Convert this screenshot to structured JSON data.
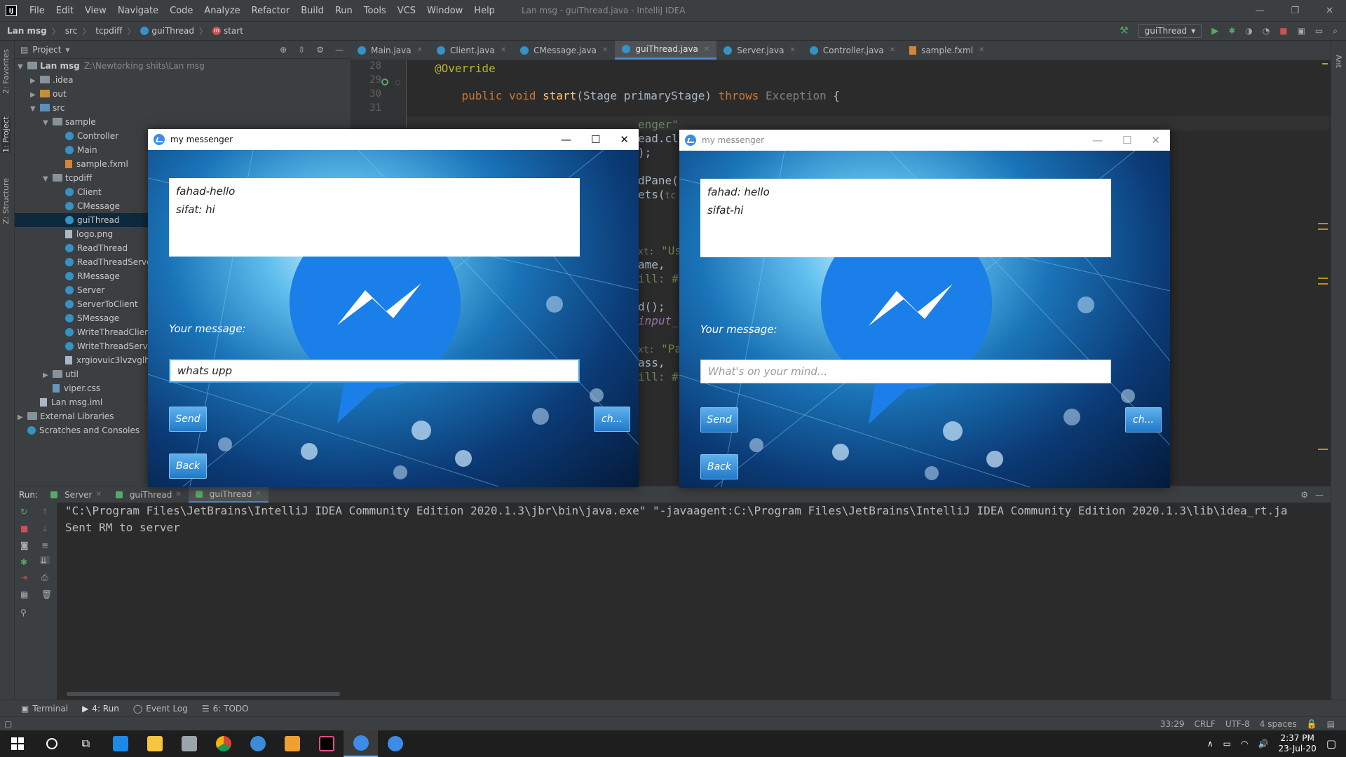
{
  "menubar": {
    "logo": "IJ",
    "items": [
      "File",
      "Edit",
      "View",
      "Navigate",
      "Code",
      "Analyze",
      "Refactor",
      "Build",
      "Run",
      "Tools",
      "VCS",
      "Window",
      "Help"
    ],
    "window_title": "Lan msg - guiThread.java - IntelliJ IDEA"
  },
  "navbar": {
    "crumbs": [
      "Lan msg",
      "src",
      "tcpdiff",
      "guiThread",
      "start"
    ],
    "run_config": "guiThread"
  },
  "left_stripe": {
    "favorites": "2: Favorites",
    "project": "1: Project",
    "structure": "Z: Structure"
  },
  "right_stripe": {
    "ant": "Ant"
  },
  "project_panel": {
    "title": "Project",
    "tree": [
      {
        "label": "Lan msg",
        "extra": "Z:\\Newtorking shits\\Lan msg",
        "indent": 0,
        "arrow": "▼",
        "icon": "folder"
      },
      {
        "label": ".idea",
        "indent": 1,
        "arrow": "▶",
        "icon": "folder"
      },
      {
        "label": "out",
        "indent": 1,
        "arrow": "▶",
        "icon": "folder-orange"
      },
      {
        "label": "src",
        "indent": 1,
        "arrow": "▼",
        "icon": "folder-blue"
      },
      {
        "label": "sample",
        "indent": 2,
        "arrow": "▼",
        "icon": "folder"
      },
      {
        "label": "Controller",
        "indent": 3,
        "arrow": "",
        "icon": "class"
      },
      {
        "label": "Main",
        "indent": 3,
        "arrow": "",
        "icon": "class"
      },
      {
        "label": "sample.fxml",
        "indent": 3,
        "arrow": "",
        "icon": "file-orange"
      },
      {
        "label": "tcpdiff",
        "indent": 2,
        "arrow": "▼",
        "icon": "folder"
      },
      {
        "label": "Client",
        "indent": 3,
        "arrow": "",
        "icon": "class"
      },
      {
        "label": "CMessage",
        "indent": 3,
        "arrow": "",
        "icon": "class"
      },
      {
        "label": "guiThread",
        "indent": 3,
        "arrow": "",
        "icon": "class",
        "selected": true
      },
      {
        "label": "logo.png",
        "indent": 3,
        "arrow": "",
        "icon": "file"
      },
      {
        "label": "ReadThread",
        "indent": 3,
        "arrow": "",
        "icon": "class"
      },
      {
        "label": "ReadThreadServer",
        "indent": 3,
        "arrow": "",
        "icon": "class"
      },
      {
        "label": "RMessage",
        "indent": 3,
        "arrow": "",
        "icon": "class"
      },
      {
        "label": "Server",
        "indent": 3,
        "arrow": "",
        "icon": "class"
      },
      {
        "label": "ServerToClient",
        "indent": 3,
        "arrow": "",
        "icon": "class"
      },
      {
        "label": "SMessage",
        "indent": 3,
        "arrow": "",
        "icon": "class"
      },
      {
        "label": "WriteThreadClient",
        "indent": 3,
        "arrow": "",
        "icon": "class"
      },
      {
        "label": "WriteThreadServer",
        "indent": 3,
        "arrow": "",
        "icon": "class"
      },
      {
        "label": "xrgiovuic3lvzvglh",
        "indent": 3,
        "arrow": "",
        "icon": "file"
      },
      {
        "label": "util",
        "indent": 2,
        "arrow": "▶",
        "icon": "folder"
      },
      {
        "label": "viper.css",
        "indent": 2,
        "arrow": "",
        "icon": "file-blue"
      },
      {
        "label": "Lan msg.iml",
        "indent": 1,
        "arrow": "",
        "icon": "file"
      },
      {
        "label": "External Libraries",
        "indent": 0,
        "arrow": "▶",
        "icon": "lib"
      },
      {
        "label": "Scratches and Consoles",
        "indent": 0,
        "arrow": "",
        "icon": "scratch"
      }
    ]
  },
  "editor": {
    "tabs": [
      {
        "label": "Main.java",
        "active": false
      },
      {
        "label": "Client.java",
        "active": false
      },
      {
        "label": "CMessage.java",
        "active": false
      },
      {
        "label": "guiThread.java",
        "active": true
      },
      {
        "label": "Server.java",
        "active": false
      },
      {
        "label": "Controller.java",
        "active": false
      },
      {
        "label": "sample.fxml",
        "active": false
      }
    ],
    "line_numbers": [
      "28",
      "29",
      "30",
      "31"
    ],
    "code": {
      "annotation": "@Override",
      "sig_public": "public",
      "sig_void": "void",
      "sig_name": "start",
      "sig_params": "(Stage primaryStage)",
      "sig_throws": "throws",
      "sig_exc": "Exception",
      "sig_brace": " {",
      "frag1": "enger\"",
      "frag2": "ead.cl",
      "frag3": ");",
      "frag4": "dPane(",
      "frag5": "ets(",
      "frag5_hint": "tc",
      "frag6_hint": "xt:",
      "frag6": "\"Use",
      "frag7": "ame,",
      "frag8": "ill: #",
      "frag9": "d();",
      "frag10": "input_n",
      "frag11_hint": "xt:",
      "frag11": "\"Pas",
      "frag12": "ass,",
      "frag13": "ill: #"
    }
  },
  "run_panel": {
    "label": "Run:",
    "tabs": [
      {
        "label": "Server",
        "active": false
      },
      {
        "label": "guiThread",
        "active": false
      },
      {
        "label": "guiThread",
        "active": true
      }
    ],
    "console": [
      "\"C:\\Program Files\\JetBrains\\IntelliJ IDEA Community Edition 2020.1.3\\jbr\\bin\\java.exe\" \"-javaagent:C:\\Program Files\\JetBrains\\IntelliJ IDEA Community Edition 2020.1.3\\lib\\idea_rt.ja",
      "Sent RM to server"
    ]
  },
  "bottom_tools": [
    "Terminal",
    "4: Run",
    "Event Log",
    "6: TODO"
  ],
  "status": {
    "pos": "33:29",
    "eol": "CRLF",
    "enc": "UTF-8",
    "indent": "4 spaces"
  },
  "taskbar": {
    "time": "2:37 PM",
    "date": "23-Jul-20"
  },
  "messenger_left": {
    "title": "my messenger",
    "chat": [
      "fahad-hello",
      "sifat: hi"
    ],
    "label": "Your message:",
    "input_value": "whats upp",
    "send": "Send",
    "change": "ch...",
    "back": "Back"
  },
  "messenger_right": {
    "title": "my messenger",
    "chat": [
      "fahad: hello",
      "sifat-hi"
    ],
    "label": "Your message:",
    "input_placeholder": "What's on your mind...",
    "send": "Send",
    "change": "ch...",
    "back": "Back"
  }
}
